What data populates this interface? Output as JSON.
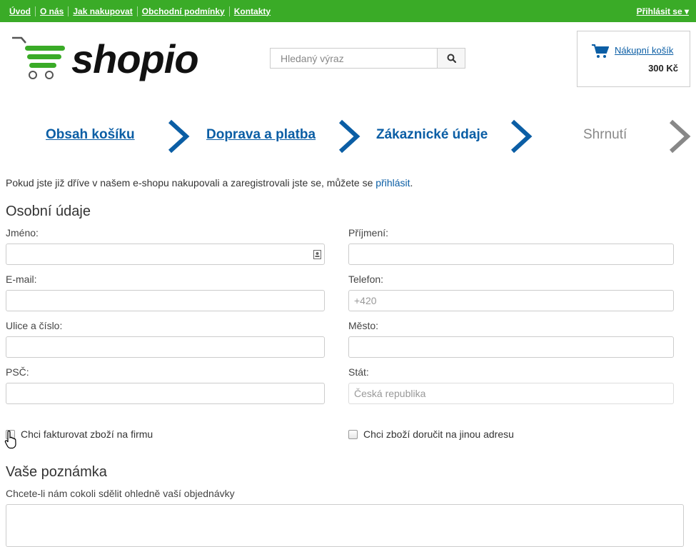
{
  "topbar": {
    "nav": [
      "Úvod",
      "O nás",
      "Jak nakupovat",
      "Obchodní podmínky",
      "Kontakty"
    ],
    "login": "Přihlásit se ▾"
  },
  "header": {
    "logo_text": "shopio",
    "search_placeholder": "Hledaný výraz",
    "cart_label": "Nákupní košík",
    "cart_price": "300 Kč"
  },
  "steps": [
    {
      "label": "Obsah košíku",
      "state": "link"
    },
    {
      "label": "Doprava a platba",
      "state": "link"
    },
    {
      "label": "Zákaznické údaje",
      "state": "current"
    },
    {
      "label": "Shrnutí",
      "state": "disabled"
    }
  ],
  "intro": {
    "text": "Pokud jste již dříve v našem e-shopu nakupovali a zaregistrovali jste se, můžete se ",
    "link": "přihlásit",
    "end": "."
  },
  "personal": {
    "title": "Osobní údaje",
    "first_name": "Jméno:",
    "last_name": "Příjmení:",
    "email": "E-mail:",
    "phone": "Telefon:",
    "phone_placeholder": "+420",
    "street": "Ulice a číslo:",
    "city": "Město:",
    "zip": "PSČ:",
    "country": "Stát:",
    "country_value": "Česká republika"
  },
  "checkboxes": {
    "company": "Chci fakturovat zboží na firmu",
    "other_address": "Chci zboží doručit na jinou adresu"
  },
  "note": {
    "title": "Vaše poznámka",
    "label": "Chcete-li nám cokoli sdělit ohledně vaší objednávky"
  },
  "colors": {
    "topbar": "#3aab27",
    "link_blue": "#0b5ea5",
    "logo_green": "#3aab27"
  }
}
